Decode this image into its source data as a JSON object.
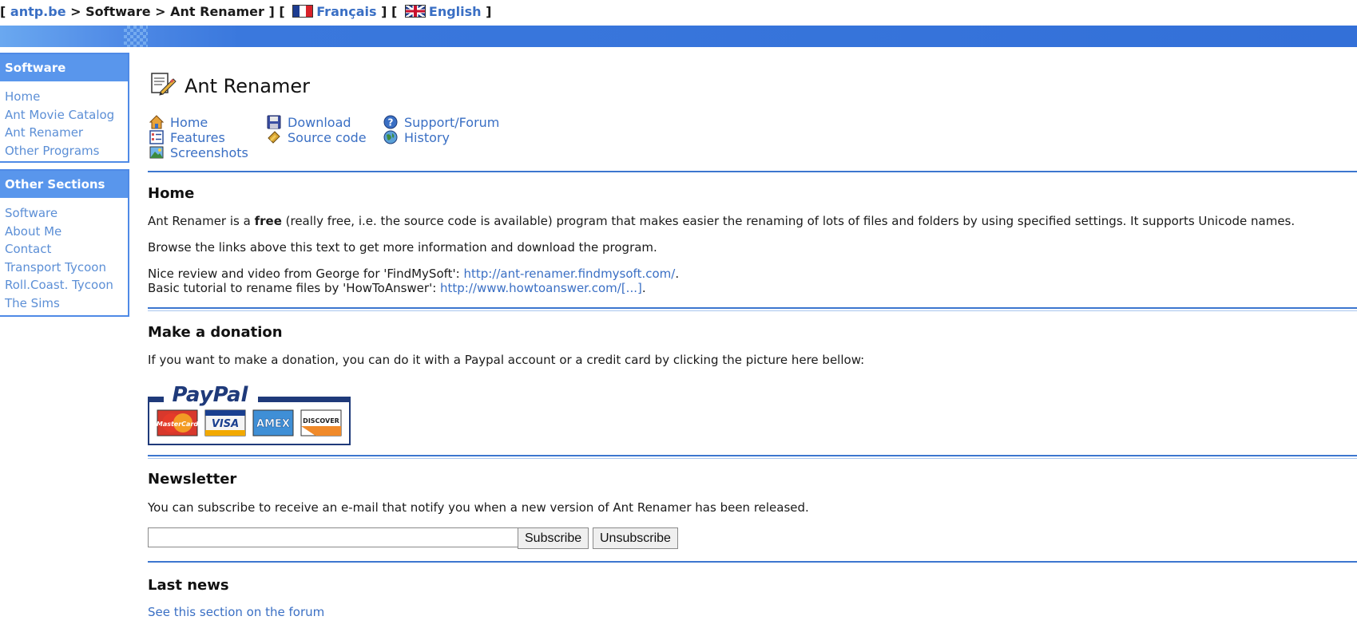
{
  "breadcrumb": {
    "open": "[",
    "site": "antp.be",
    "sep1": ">",
    "section": "Software",
    "sep2": ">",
    "page": "Ant Renamer",
    "close1": "] [",
    "lang_fr": "Français",
    "close2": "] [",
    "lang_en": "English",
    "close3": "]"
  },
  "sidebar": {
    "box1_title": "Software",
    "box1_items": [
      "Home",
      "Ant Movie Catalog",
      "Ant Renamer",
      "Other Programs"
    ],
    "box2_title": "Other Sections",
    "box2_items": [
      "Software",
      "About Me",
      "Contact",
      "Transport Tycoon",
      "Roll.Coast. Tycoon",
      "The Sims"
    ]
  },
  "page_title": "Ant Renamer",
  "nav": {
    "home": "Home",
    "features": "Features",
    "screenshots": "Screenshots",
    "download": "Download",
    "source_code": "Source code",
    "support": "Support/Forum",
    "history": "History"
  },
  "home": {
    "heading": "Home",
    "p1_before": "Ant Renamer is a ",
    "p1_bold": "free",
    "p1_after": " (really free, i.e. the source code is available) program that makes easier the renaming of lots of files and folders by using specified settings. It supports Unicode names.",
    "p2": "Browse the links above this text to get more information and download the program.",
    "p3_text": "Nice review and video from George for 'FindMySoft': ",
    "p3_link": "http://ant-renamer.findmysoft.com/",
    "p3_end": ".",
    "p4_text": "Basic tutorial to rename files by 'HowToAnswer': ",
    "p4_link": "http://www.howtoanswer.com/[...]",
    "p4_end": "."
  },
  "donation": {
    "heading": "Make a donation",
    "text": "If you want to make a donation, you can do it with a Paypal account or a credit card by clicking the picture here bellow:",
    "logo_text": "PayPal",
    "cards": [
      "MasterCard",
      "VISA",
      "AMEX",
      "DISCOVER"
    ]
  },
  "newsletter": {
    "heading": "Newsletter",
    "text": "You can subscribe to receive an e-mail that notify you when a new version of Ant Renamer has been released.",
    "email_value": "",
    "subscribe_label": "Subscribe",
    "unsubscribe_label": "Unsubscribe"
  },
  "news": {
    "heading": "Last news",
    "link": "See this section on the forum"
  },
  "colors": {
    "accent": "#3a78dd",
    "link": "#3a6fc4",
    "sidebar_link": "#5c8fd6"
  }
}
